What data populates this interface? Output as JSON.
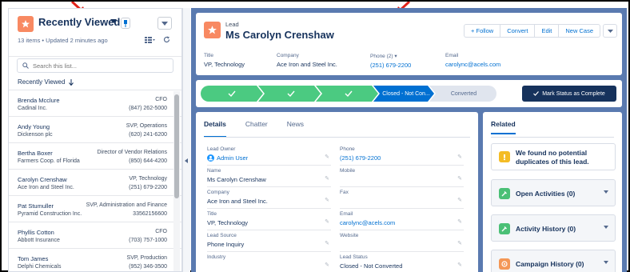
{
  "left_panel": {
    "title": "Recently Viewed",
    "subtitle": "13 items • Updated 2 minutes ago",
    "search_placeholder": "Search this list...",
    "list_header": "Recently Viewed",
    "items": [
      {
        "name": "Brenda Mcclure",
        "company": "Cadinal Inc.",
        "role": "CFO",
        "phone": "(847) 262-5000"
      },
      {
        "name": "Andy Young",
        "company": "Dickenson plc",
        "role": "SVP, Operations",
        "phone": "(620) 241-6200"
      },
      {
        "name": "Bertha Boxer",
        "company": "Farmers Coop. of Florida",
        "role": "Director of Vendor Relations",
        "phone": "(850) 644-4200"
      },
      {
        "name": "Carolyn Crenshaw",
        "company": "Ace Iron and Steel Inc.",
        "role": "VP, Technology",
        "phone": "(251) 679-2200"
      },
      {
        "name": "Pat Stumuller",
        "company": "Pyramid Construction Inc.",
        "role": "SVP, Administration and Finance",
        "phone": "33562156600"
      },
      {
        "name": "Phyllis Cotton",
        "company": "Abbott Insurance",
        "role": "CFO",
        "phone": "(703) 757-1000"
      },
      {
        "name": "Tom James",
        "company": "Delphi Chemicals",
        "role": "SVP, Production",
        "phone": "(952) 346-3500"
      }
    ]
  },
  "record": {
    "object_type": "Lead",
    "name": "Ms Carolyn Crenshaw",
    "buttons": {
      "follow": "+ Follow",
      "convert": "Convert",
      "edit": "Edit",
      "new_case": "New Case"
    },
    "highlights": {
      "title_label": "Title",
      "title_value": "VP, Technology",
      "company_label": "Company",
      "company_value": "Ace Iron and Steel Inc.",
      "phone_label": "Phone (2) ▾",
      "phone_value": "(251) 679-2200",
      "email_label": "Email",
      "email_value": "carolync@acels.com"
    }
  },
  "path": {
    "current_step": "Closed - Not Con...",
    "next_step": "Converted",
    "mark_button": "Mark Status as Complete"
  },
  "details": {
    "tabs": [
      "Details",
      "Chatter",
      "News"
    ],
    "fields": {
      "lead_owner_label": "Lead Owner",
      "lead_owner_value": "Admin User",
      "phone_label": "Phone",
      "phone_value": "(251) 679-2200",
      "name_label": "Name",
      "name_value": "Ms Carolyn Crenshaw",
      "mobile_label": "Mobile",
      "mobile_value": "",
      "company_label": "Company",
      "company_value": "Ace Iron and Steel Inc.",
      "fax_label": "Fax",
      "fax_value": "",
      "title_label": "Title",
      "title_value": "VP, Technology",
      "email_label": "Email",
      "email_value": "carolync@acels.com",
      "lead_source_label": "Lead Source",
      "lead_source_value": "Phone Inquiry",
      "website_label": "Website",
      "website_value": "",
      "industry_label": "Industry",
      "industry_value": "",
      "lead_status_label": "Lead Status",
      "lead_status_value": "Closed - Not Converted"
    }
  },
  "related": {
    "tab": "Related",
    "duplicates": "We found no potential duplicates of this lead.",
    "open_activities": "Open Activities (0)",
    "activity_history": "Activity History (0)",
    "campaign_history": "Campaign History (0)"
  },
  "colors": {
    "accent": "#0070d2",
    "path_green": "#4bca81",
    "navy": "#16325c",
    "lead_orange": "#f88962",
    "background_blue": "#5a7ab0"
  }
}
